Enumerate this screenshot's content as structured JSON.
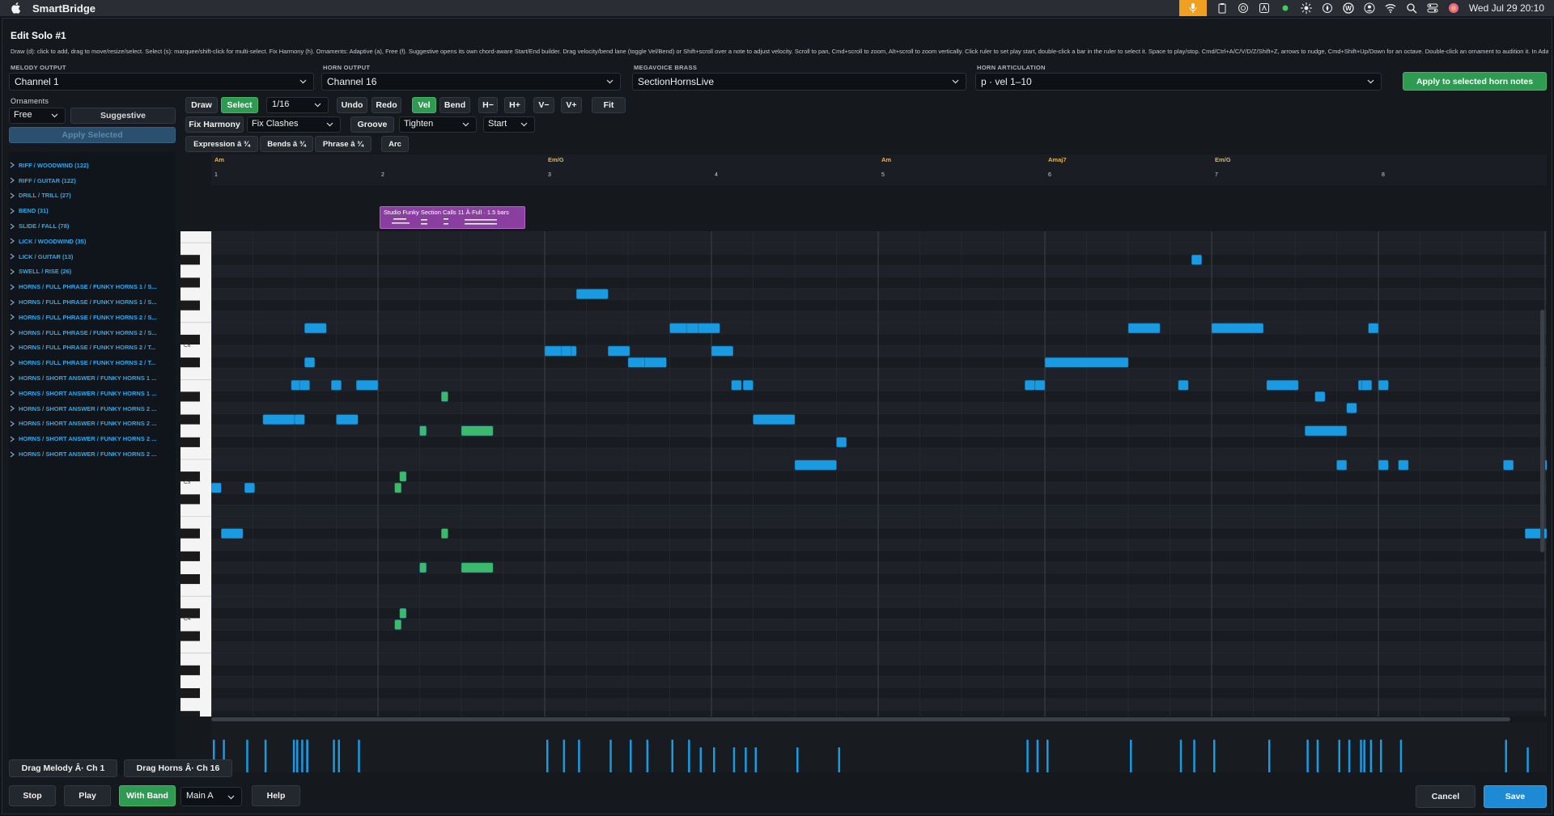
{
  "menubar": {
    "app_name": "SmartBridge",
    "datetime": "Wed Jul 29  20:10"
  },
  "dialog": {
    "title": "Edit Solo #1",
    "help": "Draw (d): click to add, drag to move/resize/select. Select (s): marquee/shift-click for multi-select. Fix Harmony (h). Ornaments: Adaptive (a), Free (f). Suggestive opens its own chord-aware Start/End builder. Drag velocity/bend lane (toggle Vel/Bend) or Shift+scroll over a note to adjust velocity. Scroll to pan, Cmd+scroll to zoom, Alt+scroll to zoom vertically. Click ruler to set play start, double-click a bar in the ruler to select it. Space to play/stop. Cmd/Ctrl+A/C/V/D/Z/Shift+Z, arrows to nudge, Cmd+Shift+Up/Down for an octave. Double-click an ornament to audition it. In Adaptive, select one and click Apply. In Free, drag it onto the lane. Delete/right..."
  },
  "outputs": {
    "melody_label": "MELODY OUTPUT",
    "melody_value": "Channel 1",
    "horn_label": "HORN OUTPUT",
    "horn_value": "Channel 16",
    "brass_label": "MEGAVOICE BRASS",
    "brass_value": "SectionHornsLive",
    "artic_label": "HORN ARTICULATION",
    "artic_value": "p  ·  vel 1–10",
    "apply_horn": "Apply to selected horn notes"
  },
  "ornaments": {
    "label": "Ornaments",
    "mode": "Free",
    "suggestive": "Suggestive",
    "apply_selected": "Apply Selected",
    "categories": [
      "RIFF / WOODWIND (122)",
      "RIFF / GUITAR (122)",
      "DRILL / TRILL (27)",
      "BEND (31)",
      "SLIDE / FALL (78)",
      "LICK / WOODWIND (35)",
      "LICK / GUITAR (13)",
      "SWELL / RISE (26)",
      "HORNS / FULL PHRASE / FUNKY HORNS 1 / S...",
      "HORNS / FULL PHRASE / FUNKY HORNS 1 / S...",
      "HORNS / FULL PHRASE / FUNKY HORNS 2 / S...",
      "HORNS / FULL PHRASE / FUNKY HORNS 2 / S...",
      "HORNS / FULL PHRASE / FUNKY HORNS 2 / T...",
      "HORNS / FULL PHRASE / FUNKY HORNS 2 / T...",
      "HORNS / SHORT ANSWER / FUNKY HORNS 1 ...",
      "HORNS / SHORT ANSWER / FUNKY HORNS 1 ...",
      "HORNS / SHORT ANSWER / FUNKY HORNS 2 ...",
      "HORNS / SHORT ANSWER / FUNKY HORNS 2 ...",
      "HORNS / SHORT ANSWER / FUNKY HORNS 2 ...",
      "HORNS / SHORT ANSWER / FUNKY HORNS 2 ..."
    ]
  },
  "toolbar": {
    "draw": "Draw",
    "select": "Select",
    "grid": "1/16",
    "undo": "Undo",
    "redo": "Redo",
    "vel": "Vel",
    "bend": "Bend",
    "h_minus": "H−",
    "h_plus": "H+",
    "v_minus": "V−",
    "v_plus": "V+",
    "fit": "Fit",
    "fix_harmony": "Fix Harmony",
    "fix_clashes": "Fix Clashes",
    "groove": "Groove",
    "tighten": "Tighten",
    "start": "Start",
    "expression": "Expression â  ¾",
    "bends": "Bends â  ¾",
    "phrase": "Phrase â  ¾",
    "arc": "Arc"
  },
  "timeline": {
    "chords": [
      {
        "label": "Am",
        "bar": 1
      },
      {
        "label": "Em/G",
        "bar": 3
      },
      {
        "label": "Am",
        "bar": 5
      },
      {
        "label": "Amaj7",
        "bar": 6
      },
      {
        "label": "Em/G",
        "bar": 7
      }
    ],
    "bars": [
      "1",
      "2",
      "3",
      "4",
      "5",
      "6",
      "7",
      "8"
    ]
  },
  "ornament_clip": {
    "label": "Studio Funky Section Calls 11 Â·Full · 1.5 bars"
  },
  "piano": {
    "labels": [
      "C6",
      "C5",
      "C4"
    ]
  },
  "footer": {
    "drag_melody": "Drag Melody Â· Ch 1",
    "drag_horns": "Drag Horns Â· Ch 16",
    "stop": "Stop",
    "play": "Play",
    "with_band": "With Band",
    "section": "Main A",
    "help": "Help",
    "cancel": "Cancel",
    "save": "Save"
  },
  "colors": {
    "note_blue": "#1a9ae0",
    "note_green": "#3cb96a",
    "chord_gold": "#f0b430",
    "clip_purple": "#8a3fa0"
  },
  "notes": {
    "blue": [
      {
        "start": 0.06,
        "len": 0.13,
        "pitch": 58
      },
      {
        "start": 0.0,
        "len": 0.06,
        "pitch": 62
      },
      {
        "start": 0.2,
        "len": 0.06,
        "pitch": 62
      },
      {
        "start": 0.31,
        "len": 0.19,
        "pitch": 68
      },
      {
        "start": 0.48,
        "len": 0.06,
        "pitch": 71
      },
      {
        "start": 0.5,
        "len": 0.06,
        "pitch": 68
      },
      {
        "start": 0.53,
        "len": 0.06,
        "pitch": 71
      },
      {
        "start": 0.72,
        "len": 0.06,
        "pitch": 71
      },
      {
        "start": 0.75,
        "len": 0.13,
        "pitch": 68
      },
      {
        "start": 0.87,
        "len": 0.13,
        "pitch": 71
      },
      {
        "start": 0.56,
        "len": 0.06,
        "pitch": 73
      },
      {
        "start": 0.56,
        "len": 0.13,
        "pitch": 76
      },
      {
        "start": 2.0,
        "len": 0.19,
        "pitch": 74
      },
      {
        "start": 2.1,
        "len": 0.06,
        "pitch": 74
      },
      {
        "start": 2.19,
        "len": 0.19,
        "pitch": 79
      },
      {
        "start": 2.38,
        "len": 0.13,
        "pitch": 74
      },
      {
        "start": 2.5,
        "len": 0.13,
        "pitch": 73
      },
      {
        "start": 2.6,
        "len": 0.13,
        "pitch": 73
      },
      {
        "start": 2.75,
        "len": 0.13,
        "pitch": 76
      },
      {
        "start": 2.85,
        "len": 0.13,
        "pitch": 76
      },
      {
        "start": 2.92,
        "len": 0.13,
        "pitch": 76
      },
      {
        "start": 3.0,
        "len": 0.13,
        "pitch": 74
      },
      {
        "start": 3.12,
        "len": 0.06,
        "pitch": 71
      },
      {
        "start": 3.19,
        "len": 0.06,
        "pitch": 71
      },
      {
        "start": 3.25,
        "len": 0.25,
        "pitch": 68
      },
      {
        "start": 3.5,
        "len": 0.25,
        "pitch": 64
      },
      {
        "start": 3.75,
        "len": 0.06,
        "pitch": 66
      },
      {
        "start": 4.88,
        "len": 0.06,
        "pitch": 71
      },
      {
        "start": 4.94,
        "len": 0.06,
        "pitch": 71
      },
      {
        "start": 5.0,
        "len": 0.5,
        "pitch": 73
      },
      {
        "start": 5.5,
        "len": 0.19,
        "pitch": 76
      },
      {
        "start": 5.88,
        "len": 0.06,
        "pitch": 82
      },
      {
        "start": 5.8,
        "len": 0.06,
        "pitch": 71
      },
      {
        "start": 6.0,
        "len": 0.31,
        "pitch": 76
      },
      {
        "start": 6.33,
        "len": 0.19,
        "pitch": 71
      },
      {
        "start": 6.56,
        "len": 0.25,
        "pitch": 67
      },
      {
        "start": 6.81,
        "len": 0.06,
        "pitch": 69
      },
      {
        "start": 6.88,
        "len": 0.06,
        "pitch": 71
      },
      {
        "start": 6.94,
        "len": 0.06,
        "pitch": 76
      },
      {
        "start": 7.0,
        "len": 0.06,
        "pitch": 64
      },
      {
        "start": 7.12,
        "len": 0.06,
        "pitch": 64
      },
      {
        "start": 6.62,
        "len": 0.06,
        "pitch": 70
      },
      {
        "start": 6.75,
        "len": 0.06,
        "pitch": 64
      },
      {
        "start": 7.0,
        "len": 0.06,
        "pitch": 71
      },
      {
        "start": 6.9,
        "len": 0.06,
        "pitch": 71
      },
      {
        "start": 7.88,
        "len": 0.13,
        "pitch": 58
      },
      {
        "start": 7.75,
        "len": 0.06,
        "pitch": 64
      },
      {
        "start": 8.0,
        "len": 0.06,
        "pitch": 64
      },
      {
        "start": 8.06,
        "len": 0.06,
        "pitch": 62
      },
      {
        "start": 8.2,
        "len": 0.06,
        "pitch": 62
      },
      {
        "start": 8.31,
        "len": 0.06,
        "pitch": 64
      },
      {
        "start": 8.38,
        "len": 0.06,
        "pitch": 62
      }
    ],
    "green": [
      {
        "start": 1.1,
        "len": 0.04,
        "pitch": 50
      },
      {
        "start": 1.13,
        "len": 0.04,
        "pitch": 51
      },
      {
        "start": 1.25,
        "len": 0.04,
        "pitch": 55
      },
      {
        "start": 1.5,
        "len": 0.19,
        "pitch": 55
      },
      {
        "start": 1.38,
        "len": 0.04,
        "pitch": 58
      },
      {
        "start": 1.1,
        "len": 0.04,
        "pitch": 62
      },
      {
        "start": 1.13,
        "len": 0.04,
        "pitch": 63
      },
      {
        "start": 1.25,
        "len": 0.04,
        "pitch": 67
      },
      {
        "start": 1.5,
        "len": 0.19,
        "pitch": 67
      },
      {
        "start": 1.38,
        "len": 0.04,
        "pitch": 70
      }
    ]
  },
  "velocity": [
    0.72,
    0.72,
    0.72,
    0.72,
    0.72,
    0.72,
    0.72,
    0.72,
    0.72,
    0.72,
    0.72,
    0.72,
    0.72,
    0.72,
    0.72,
    0.72,
    0.72,
    0.72,
    0.72,
    0.72,
    0.55,
    0.55,
    0.55,
    0.55,
    0.55,
    0.55,
    0.55,
    0.72,
    0.72,
    0.72,
    0.72,
    0.72,
    0.72,
    0.72,
    0.72,
    0.72,
    0.72,
    0.72,
    0.72,
    0.72,
    0.72,
    0.72,
    0.72,
    0.72,
    0.72,
    0.72,
    0.55,
    0.55,
    0.55,
    0.55,
    0.55,
    0.55,
    0.55,
    0.55,
    0.55,
    0.55,
    0.72,
    0.72,
    0.72,
    0.72,
    0.72,
    0.72,
    0.72,
    0.72
  ]
}
